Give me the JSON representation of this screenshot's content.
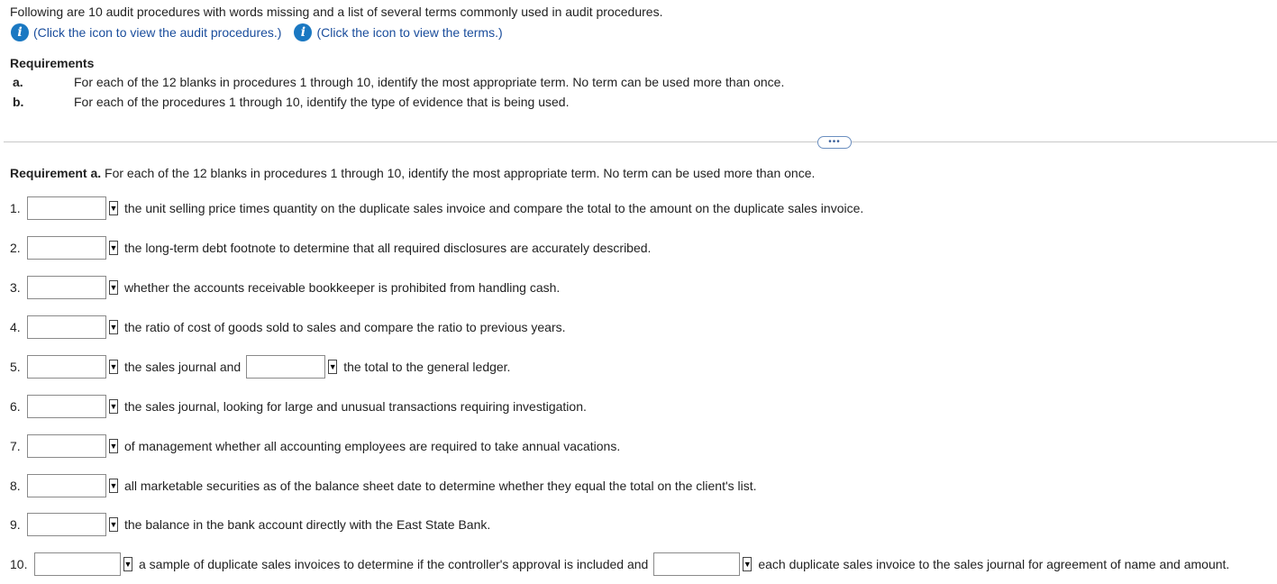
{
  "intro": "Following are 10 audit procedures with words missing and a list of several terms commonly used in audit procedures.",
  "links": {
    "procedures": "(Click the icon to view the audit procedures.)",
    "terms": "(Click the icon to view the terms.)",
    "icon_glyph": "i"
  },
  "requirements": {
    "title": "Requirements",
    "a_letter": "a.",
    "a_text": "For each of the 12 blanks in procedures 1 through 10, identify the most appropriate term. No term can be used more than once.",
    "b_letter": "b.",
    "b_text": "For each of the procedures 1 through 10, identify the type of evidence that is being used."
  },
  "more_button": "•••",
  "req_a": {
    "label": "Requirement a.",
    "text": " For each of the 12 blanks in procedures 1 through 10, identify the most appropriate term. No term can be used more than once."
  },
  "dropdown_arrow": "▼",
  "items": [
    {
      "num": "1.",
      "text1": "the unit selling price times quantity on the duplicate sales invoice and compare the total to the amount on the duplicate sales invoice."
    },
    {
      "num": "2.",
      "text1": "the long-term debt footnote to determine that all required disclosures are accurately described."
    },
    {
      "num": "3.",
      "text1": "whether the accounts receivable bookkeeper is prohibited from handling cash."
    },
    {
      "num": "4.",
      "text1": "the ratio of cost of goods sold to sales and compare the ratio to previous years."
    },
    {
      "num": "5.",
      "text1": "the sales journal and",
      "text2": "the total to the general ledger."
    },
    {
      "num": "6.",
      "text1": " the sales journal, looking for large and unusual transactions requiring investigation."
    },
    {
      "num": "7.",
      "text1": "of management whether all accounting employees are required to take annual vacations."
    },
    {
      "num": "8.",
      "text1": "all marketable securities as of the balance sheet date to determine whether they equal the total on the client's list."
    },
    {
      "num": "9.",
      "text1": "the balance in the bank account directly with the East State Bank."
    },
    {
      "num": "10.",
      "text1": "a sample of duplicate sales invoices to determine if the controller's approval is included and",
      "text2": "each duplicate sales invoice to the sales journal for agreement of name and amount."
    }
  ]
}
